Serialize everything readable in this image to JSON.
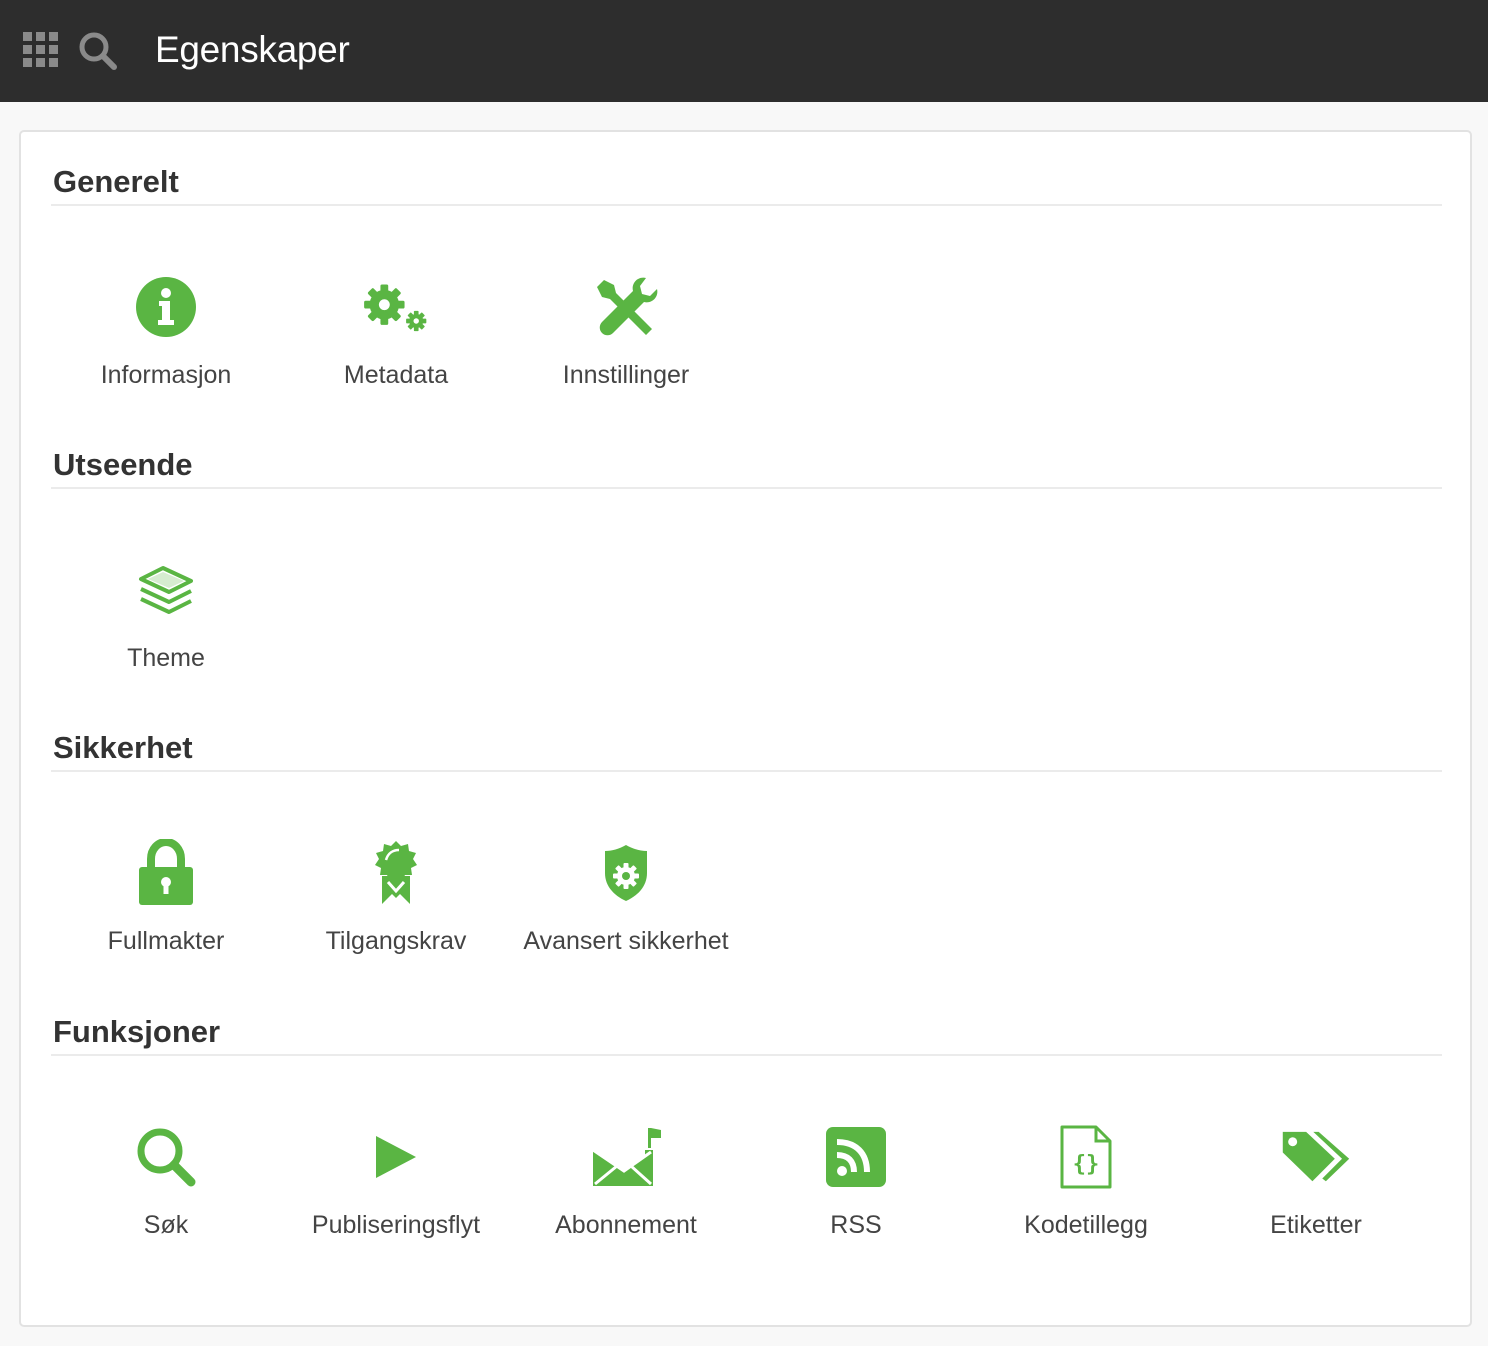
{
  "header": {
    "title": "Egenskaper",
    "apps_icon": "apps-grid-icon",
    "search_icon": "search-icon"
  },
  "colors": {
    "accent": "#5ab543",
    "header_bg": "#2d2d2d",
    "header_icon": "#8a8a8a"
  },
  "sections": [
    {
      "title": "Generelt",
      "items": [
        {
          "label": "Informasjon",
          "icon": "info-circle-icon"
        },
        {
          "label": "Metadata",
          "icon": "gears-icon"
        },
        {
          "label": "Innstillinger",
          "icon": "wrench-screwdriver-icon"
        }
      ]
    },
    {
      "title": "Utseende",
      "items": [
        {
          "label": "Theme",
          "icon": "layers-icon"
        }
      ]
    },
    {
      "title": "Sikkerhet",
      "items": [
        {
          "label": "Fullmakter",
          "icon": "padlock-icon"
        },
        {
          "label": "Tilgangskrav",
          "icon": "award-ribbon-icon"
        },
        {
          "label": "Avansert sikkerhet",
          "icon": "shield-gear-icon"
        }
      ]
    },
    {
      "title": "Funksjoner",
      "items": [
        {
          "label": "Søk",
          "icon": "magnifier-icon"
        },
        {
          "label": "Publiseringsflyt",
          "icon": "play-icon"
        },
        {
          "label": "Abonnement",
          "icon": "envelope-flag-icon"
        },
        {
          "label": "RSS",
          "icon": "rss-feed-icon"
        },
        {
          "label": "Kodetillegg",
          "icon": "code-file-icon"
        },
        {
          "label": "Etiketter",
          "icon": "tags-icon"
        }
      ]
    }
  ]
}
